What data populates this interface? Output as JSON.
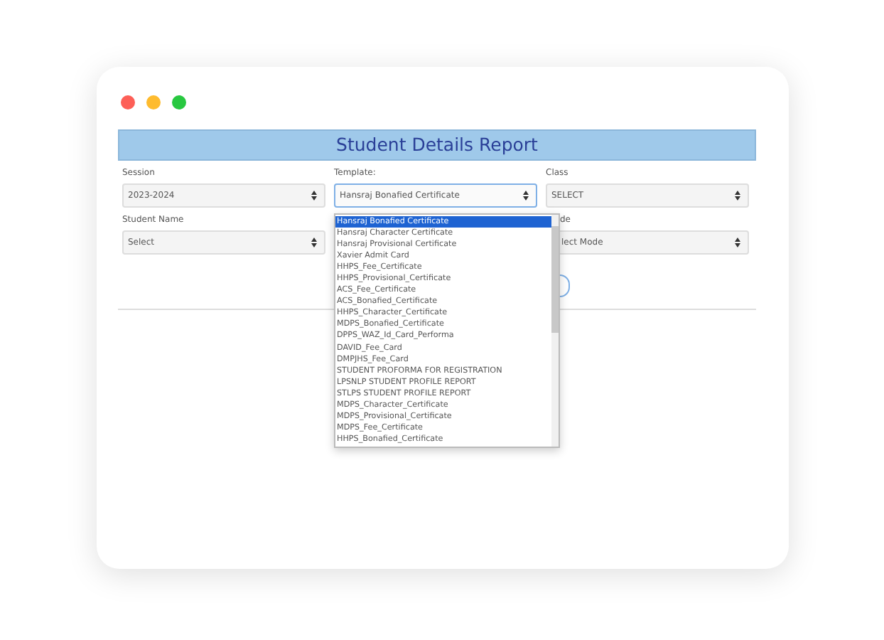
{
  "title": "Student Details Report",
  "fields": [
    {
      "label": "Session",
      "value": "2023-2024",
      "focused": false
    },
    {
      "label": "Template:",
      "value": "Hansraj  Bonafied Certificate",
      "focused": true
    },
    {
      "label": "Class",
      "value": "SELECT",
      "focused": false
    },
    {
      "label": "Student Name",
      "value": "Select",
      "focused": false
    },
    {
      "label": "de",
      "value": "lect Mode",
      "focused": false
    }
  ],
  "dropdown": [
    {
      "label": "Hansraj  Bonafied Certificate",
      "selected": true
    },
    {
      "label": "Hansraj Character Certificate",
      "selected": false
    },
    {
      "label": "Hansraj  Provisional Certificate",
      "selected": false
    },
    {
      "label": "Xavier Admit Card",
      "selected": false
    },
    {
      "label": "HHPS_Fee_Certificate",
      "selected": false
    },
    {
      "label": "HHPS_Provisional_Certificate",
      "selected": false
    },
    {
      "label": "ACS_Fee_Certificate",
      "selected": false
    },
    {
      "label": "ACS_Bonafied_Certificate",
      "selected": false
    },
    {
      "label": "HHPS_Character_Certificate",
      "selected": false
    },
    {
      "label": "MDPS_Bonafied_Certificate",
      "selected": false
    },
    {
      "label": "DPPS_WAZ_Id_Card_Performa",
      "selected": false
    },
    {
      "label": "DAVID_Fee_Card",
      "selected": false
    },
    {
      "label": "DMPJHS_Fee_Card",
      "selected": false
    },
    {
      "label": "STUDENT  PROFORMA  FOR  REGISTRATION",
      "selected": false
    },
    {
      "label": "LPSNLP STUDENT  PROFILE  REPORT",
      "selected": false
    },
    {
      "label": "STLPS STUDENT  PROFILE  REPORT",
      "selected": false
    },
    {
      "label": "MDPS_Character_Certificate",
      "selected": false
    },
    {
      "label": "MDPS_Provisional_Certificate",
      "selected": false
    },
    {
      "label": "MDPS_Fee_Certificate",
      "selected": false
    },
    {
      "label": "HHPS_Bonafied_Certificate",
      "selected": false
    }
  ]
}
